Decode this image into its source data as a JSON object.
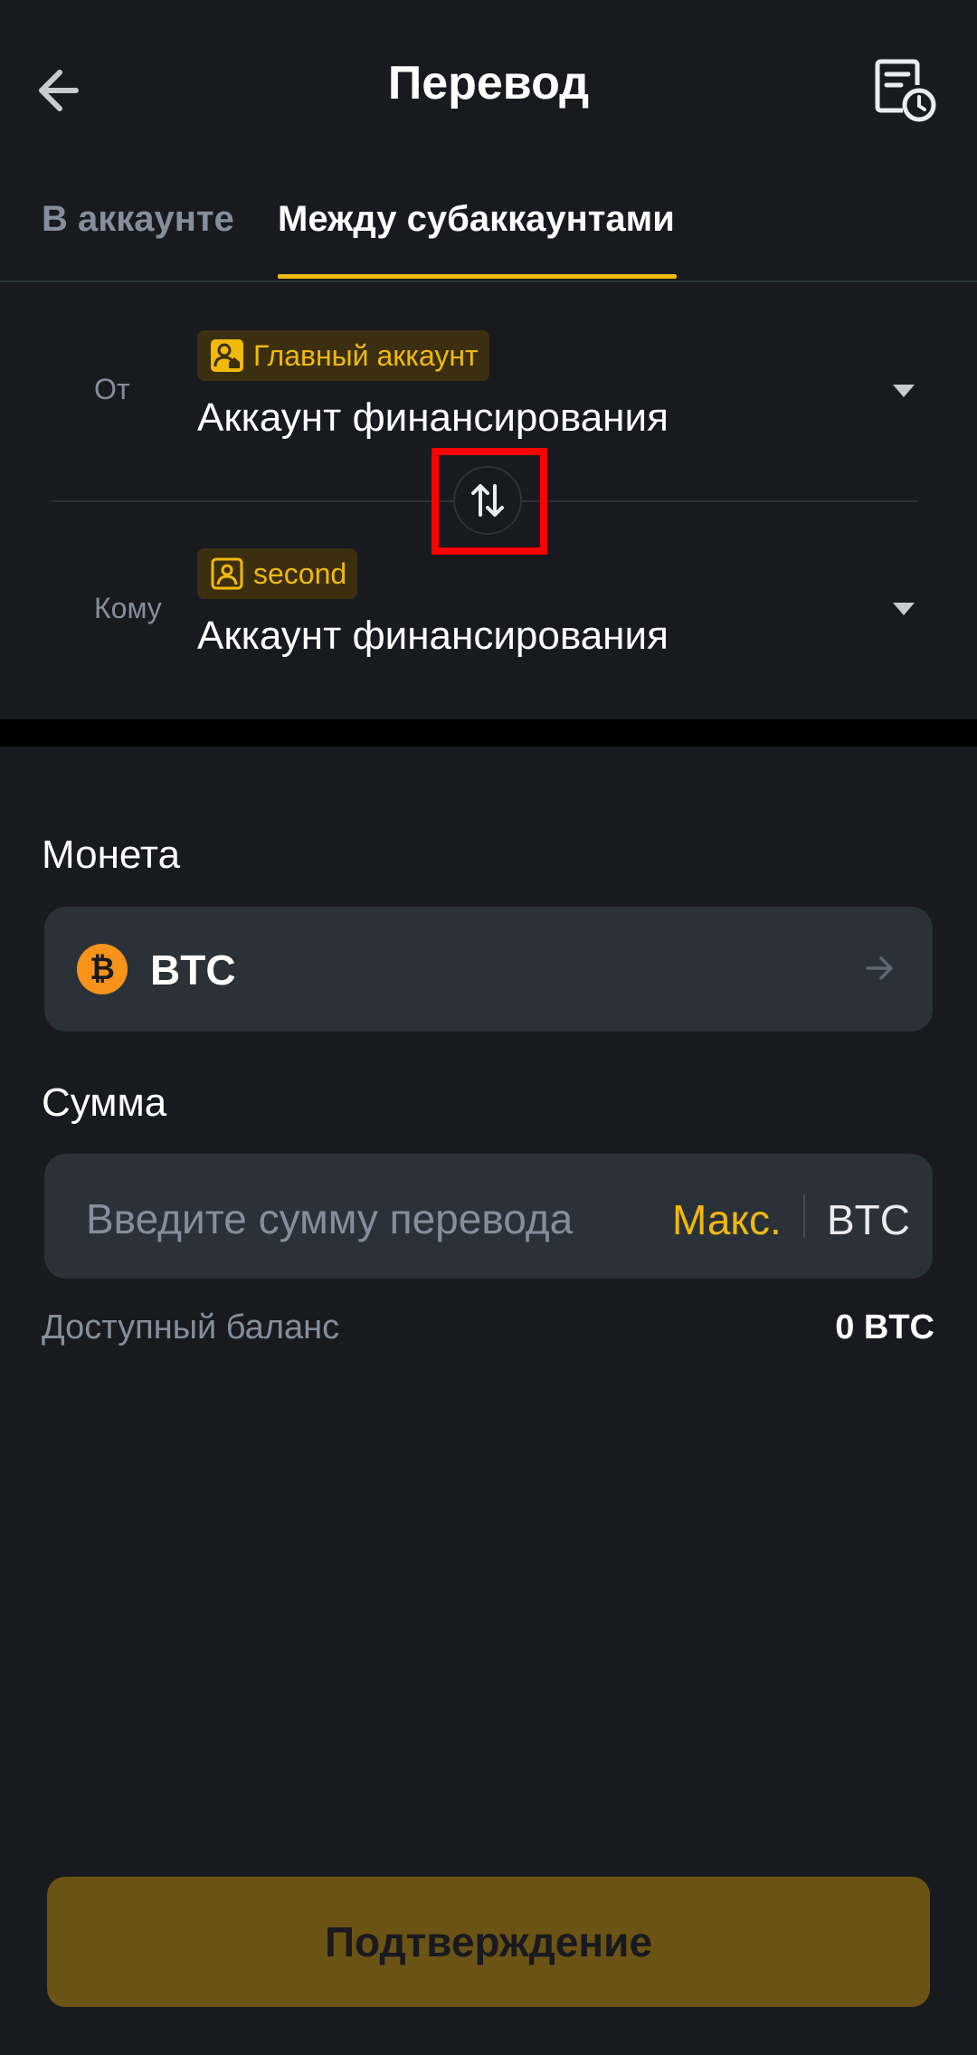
{
  "header": {
    "title": "Перевод",
    "back_icon": "arrow-left-icon",
    "history_icon": "history-document-icon"
  },
  "tabs": [
    {
      "label": "В аккаунте",
      "active": false
    },
    {
      "label": "Между субаккаунтами",
      "active": true
    }
  ],
  "transfer": {
    "from": {
      "label": "От",
      "tag": "Главный аккаунт",
      "tag_icon": "main-account-icon",
      "account": "Аккаунт финансирования"
    },
    "to": {
      "label": "Кому",
      "tag": "second",
      "tag_icon": "sub-account-icon",
      "account": "Аккаунт финансирования"
    },
    "swap_icon": "swap-arrows-icon"
  },
  "coin": {
    "label": "Монета",
    "value": "BTC",
    "icon": "bitcoin-icon",
    "icon_glyph": "₿"
  },
  "amount": {
    "label": "Сумма",
    "placeholder": "Введите сумму перевода",
    "max_label": "Макс.",
    "unit": "BTC"
  },
  "balance": {
    "label": "Доступный баланс",
    "value": "0 BTC"
  },
  "confirm_label": "Подтверждение",
  "colors": {
    "background": "#181A20",
    "accent": "#F0B90B",
    "field": "#2B3139",
    "highlight": "#FF0000"
  }
}
